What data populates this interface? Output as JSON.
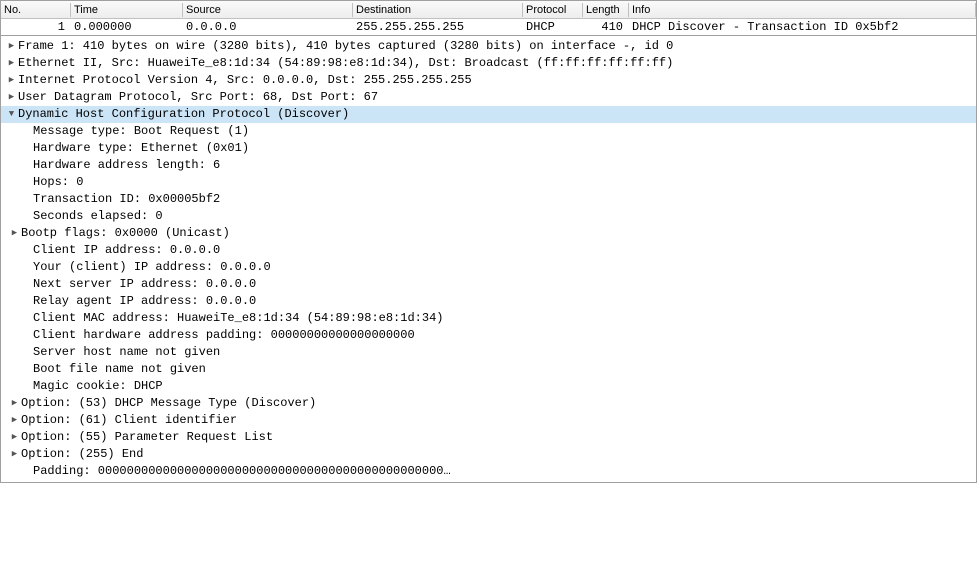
{
  "packet_list": {
    "headers": {
      "no": "No.",
      "time": "Time",
      "source": "Source",
      "dest": "Destination",
      "proto": "Protocol",
      "len": "Length",
      "info": "Info"
    },
    "row": {
      "no": "1",
      "time": "0.000000",
      "source": "0.0.0.0",
      "dest": "255.255.255.255",
      "proto": "DHCP",
      "len": "410",
      "info": "DHCP Discover - Transaction ID 0x5bf2"
    }
  },
  "details": {
    "frame": "Frame 1: 410 bytes on wire (3280 bits), 410 bytes captured (3280 bits) on interface -, id 0",
    "eth": "Ethernet II, Src: HuaweiTe_e8:1d:34 (54:89:98:e8:1d:34), Dst: Broadcast (ff:ff:ff:ff:ff:ff)",
    "ip": "Internet Protocol Version 4, Src: 0.0.0.0, Dst: 255.255.255.255",
    "udp": "User Datagram Protocol, Src Port: 68, Dst Port: 67",
    "dhcp": "Dynamic Host Configuration Protocol (Discover)",
    "dhcp_children": {
      "msgtype": "Message type: Boot Request (1)",
      "hwtype": "Hardware type: Ethernet (0x01)",
      "hwlen": "Hardware address length: 6",
      "hops": "Hops: 0",
      "xid": "Transaction ID: 0x00005bf2",
      "secs": "Seconds elapsed: 0",
      "flags": "Bootp flags: 0x0000 (Unicast)",
      "ciaddr": "Client IP address: 0.0.0.0",
      "yiaddr": "Your (client) IP address: 0.0.0.0",
      "siaddr": "Next server IP address: 0.0.0.0",
      "giaddr": "Relay agent IP address: 0.0.0.0",
      "chaddr": "Client MAC address: HuaweiTe_e8:1d:34 (54:89:98:e8:1d:34)",
      "chpad": "Client hardware address padding: 00000000000000000000",
      "sname": "Server host name not given",
      "bfile": "Boot file name not given",
      "cookie": "Magic cookie: DHCP",
      "opt53": "Option: (53) DHCP Message Type (Discover)",
      "opt61": "Option: (61) Client identifier",
      "opt55": "Option: (55) Parameter Request List",
      "opt255": "Option: (255) End",
      "padding": "Padding: 000000000000000000000000000000000000000000000000…"
    }
  }
}
